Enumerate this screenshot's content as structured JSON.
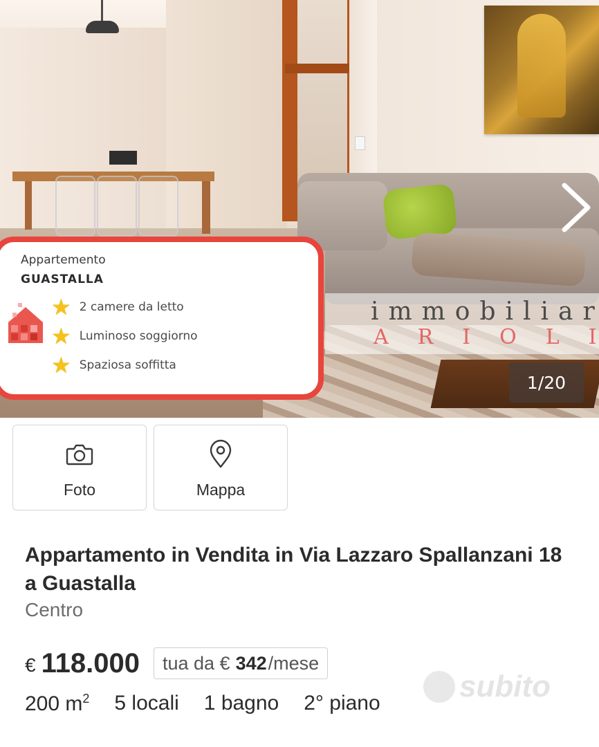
{
  "gallery": {
    "counter": "1/20",
    "overlay": {
      "type": "Appartemento",
      "city": "GUASTALLA",
      "features": [
        "2 camere da letto",
        "Luminoso soggiorno",
        "Spaziosa soffitta"
      ]
    },
    "brand": {
      "line1": "immobiliare",
      "line2": "ARIOLI"
    }
  },
  "actions": {
    "photo_label": "Foto",
    "map_label": "Mappa"
  },
  "listing": {
    "title": "Appartamento in Vendita in Via Lazzaro Spallanzani 18 a Guastalla",
    "zone": "Centro",
    "currency": "€",
    "price": "118.000",
    "mortgage": {
      "prefix": "tua da €",
      "amount": "342",
      "suffix": "/mese"
    },
    "specs": {
      "surface": "200 m",
      "surface_exp": "2",
      "rooms": "5 locali",
      "bath": "1 bagno",
      "floor": "2° piano"
    }
  },
  "watermark": "subito",
  "colors": {
    "accent_red": "#e8453c",
    "star": "#f4c21a",
    "text": "#2b2b2b",
    "muted": "#6d6d6d"
  },
  "icons": [
    "chevron-right-icon",
    "star-icon",
    "camera-icon",
    "map-pin-icon",
    "house-logo-icon"
  ]
}
